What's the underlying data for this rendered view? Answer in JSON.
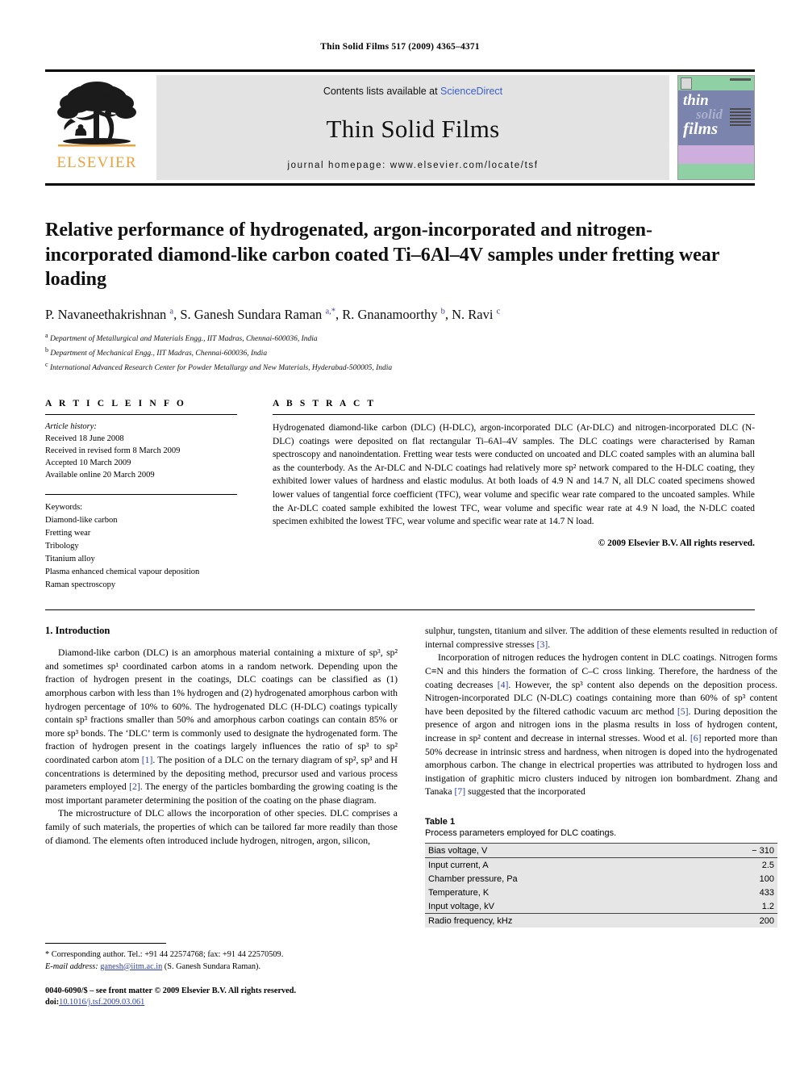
{
  "running_head": "Thin Solid Films 517 (2009) 4365–4371",
  "masthead": {
    "contents_prefix": "Contents lists available at ",
    "sciencedirect": "ScienceDirect",
    "journal_name": "Thin Solid Films",
    "homepage": "journal homepage: www.elsevier.com/locate/tsf",
    "publisher_wordmark": "ELSEVIER",
    "cover": {
      "line1": "thin",
      "line2": "solid",
      "line3": "films"
    },
    "link_color": "#3a5fcd",
    "elsevier_orange": "#e7a33e"
  },
  "article": {
    "title": "Relative performance of hydrogenated, argon-incorporated and nitrogen-incorporated diamond-like carbon coated Ti–6Al–4V samples under fretting wear loading",
    "authors_html": "P. Navaneethakrishnan <sup class=\"aff-mark\">a</sup>, S. Ganesh Sundara Raman <sup class=\"aff-mark\">a,*</sup>, R. Gnanamoorthy <sup class=\"aff-mark\">b</sup>, N. Ravi <sup class=\"aff-mark\">c</sup>",
    "affiliations": [
      {
        "mark": "a",
        "text": "Department of Metallurgical and Materials Engg., IIT Madras, Chennai-600036, India"
      },
      {
        "mark": "b",
        "text": "Department of Mechanical Engg., IIT Madras, Chennai-600036, India"
      },
      {
        "mark": "c",
        "text": "International Advanced Research Center for Powder Metallurgy and New Materials, Hyderabad-500005, India"
      }
    ]
  },
  "article_info": {
    "heading": "A R T I C L E   I N F O",
    "history_label": "Article history:",
    "history": [
      "Received 18 June 2008",
      "Received in revised form 8 March 2009",
      "Accepted 10 March 2009",
      "Available online 20 March 2009"
    ],
    "keywords_label": "Keywords:",
    "keywords": [
      "Diamond-like carbon",
      "Fretting wear",
      "Tribology",
      "Titanium alloy",
      "Plasma enhanced chemical vapour deposition",
      "Raman spectroscopy"
    ]
  },
  "abstract": {
    "heading": "A B S T R A C T",
    "text": "Hydrogenated diamond-like carbon (DLC) (H-DLC), argon-incorporated DLC (Ar-DLC) and nitrogen-incorporated DLC (N-DLC) coatings were deposited on flat rectangular Ti–6Al–4V samples. The DLC coatings were characterised by Raman spectroscopy and nanoindentation. Fretting wear tests were conducted on uncoated and DLC coated samples with an alumina ball as the counterbody. As the Ar-DLC and N-DLC coatings had relatively more sp² network compared to the H-DLC coating, they exhibited lower values of hardness and elastic modulus. At both loads of 4.9 N and 14.7 N, all DLC coated specimens showed lower values of tangential force coefficient (TFC), wear volume and specific wear rate compared to the uncoated samples. While the Ar-DLC coated sample exhibited the lowest TFC, wear volume and specific wear rate at 4.9 N load, the N-DLC coated specimen exhibited the lowest TFC, wear volume and specific wear rate at 14.7 N load.",
    "copyright": "© 2009 Elsevier B.V. All rights reserved."
  },
  "body": {
    "section_heading": "1. Introduction",
    "left_paragraphs": [
      "Diamond-like carbon (DLC) is an amorphous material containing a mixture of sp³, sp² and sometimes sp¹ coordinated carbon atoms in a random network. Depending upon the fraction of hydrogen present in the coatings, DLC coatings can be classified as (1) amorphous carbon with less than 1% hydrogen and (2) hydrogenated amorphous carbon with hydrogen percentage of 10% to 60%. The hydrogenated DLC (H-DLC) coatings typically contain sp³ fractions smaller than 50% and amorphous carbon coatings can contain 85% or more sp³ bonds. The ‘DLC’ term is commonly used to designate the hydrogenated form. The fraction of hydrogen present in the coatings largely influences the ratio of sp³ to sp² coordinated carbon atom [1]. The position of a DLC on the ternary diagram of sp², sp³ and H concentrations is determined by the depositing method, precursor used and various process parameters employed [2]. The energy of the particles bombarding the growing coating is the most important parameter determining the position of the coating on the phase diagram.",
      "The microstructure of DLC allows the incorporation of other species. DLC comprises a family of such materials, the properties of which can be tailored far more readily than those of diamond. The elements often introduced include hydrogen, nitrogen, argon, silicon,"
    ],
    "right_paragraphs": [
      "sulphur, tungsten, titanium and silver. The addition of these elements resulted in reduction of internal compressive stresses [3].",
      "Incorporation of nitrogen reduces the hydrogen content in DLC coatings. Nitrogen forms C≡N and this hinders the formation of C–C cross linking. Therefore, the hardness of the coating decreases [4]. However, the sp³ content also depends on the deposition process. Nitrogen-incorporated DLC (N-DLC) coatings containing more than 60% of sp³ content have been deposited by the filtered cathodic vacuum arc method [5]. During deposition the presence of argon and nitrogen ions in the plasma results in loss of hydrogen content, increase in sp² content and decrease in internal stresses. Wood et al. [6] reported more than 50% decrease in intrinsic stress and hardness, when nitrogen is doped into the hydrogenated amorphous carbon. The change in electrical properties was attributed to hydrogen loss and instigation of graphitic micro clusters induced by nitrogen ion bombardment. Zhang and Tanaka [7] suggested that the incorporated"
    ],
    "citation_color": "#2b3f9e"
  },
  "table1": {
    "label": "Table 1",
    "caption": "Process parameters employed for DLC coatings.",
    "rows": [
      {
        "parameter": "Bias voltage, V",
        "value": "− 310"
      },
      {
        "parameter": "Input current, A",
        "value": "2.5"
      },
      {
        "parameter": "Chamber pressure, Pa",
        "value": "100"
      },
      {
        "parameter": "Temperature, K",
        "value": "433"
      },
      {
        "parameter": "Input voltage, kV",
        "value": "1.2"
      },
      {
        "parameter": "Radio frequency, kHz",
        "value": "200"
      }
    ]
  },
  "footnote": {
    "corresponding": "* Corresponding author. Tel.: +91 44 22574768; fax: +91 44 22570509.",
    "email_label": "E-mail address:",
    "email": "ganesh@iitm.ac.in",
    "email_suffix": " (S. Ganesh Sundara Raman).",
    "issn": "0040-6090/$ – see front matter © 2009 Elsevier B.V. All rights reserved.",
    "doi_label": "doi:",
    "doi": "10.1016/j.tsf.2009.03.061"
  }
}
